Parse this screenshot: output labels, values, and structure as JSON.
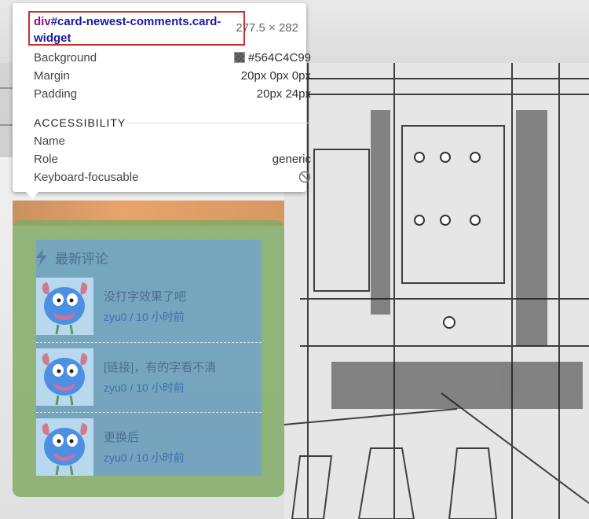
{
  "tooltip": {
    "tag": "div",
    "selector": "#card-newest-comments.card-widget",
    "dimensions": "277.5 × 282",
    "props": [
      {
        "name": "Background",
        "value": "#564C4C99",
        "swatch": true
      },
      {
        "name": "Margin",
        "value": "20px 0px 0px"
      },
      {
        "name": "Padding",
        "value": "20px 24px"
      }
    ],
    "accessibility_title": "ACCESSIBILITY",
    "accessibility": [
      {
        "name": "Name",
        "value": ""
      },
      {
        "name": "Role",
        "value": "generic"
      },
      {
        "name": "Keyboard-focusable",
        "value": "",
        "icon": "not-allowed-icon"
      }
    ]
  },
  "card": {
    "title": "最新评论",
    "title_icon": "bolt-icon",
    "comments": [
      {
        "text": "没打字效果了吧",
        "author": "zyu0",
        "time": "10 小时前"
      },
      {
        "text": "[链接]，有的字看不清",
        "author": "zyu0",
        "time": "10 小时前"
      },
      {
        "text": "更换后",
        "author": "zyu0",
        "time": "10 小时前"
      }
    ]
  },
  "colors": {
    "margin_overlay": "#81AA64",
    "content_overlay": "#6EA0D2",
    "selector_border": "#CC2F2F"
  }
}
